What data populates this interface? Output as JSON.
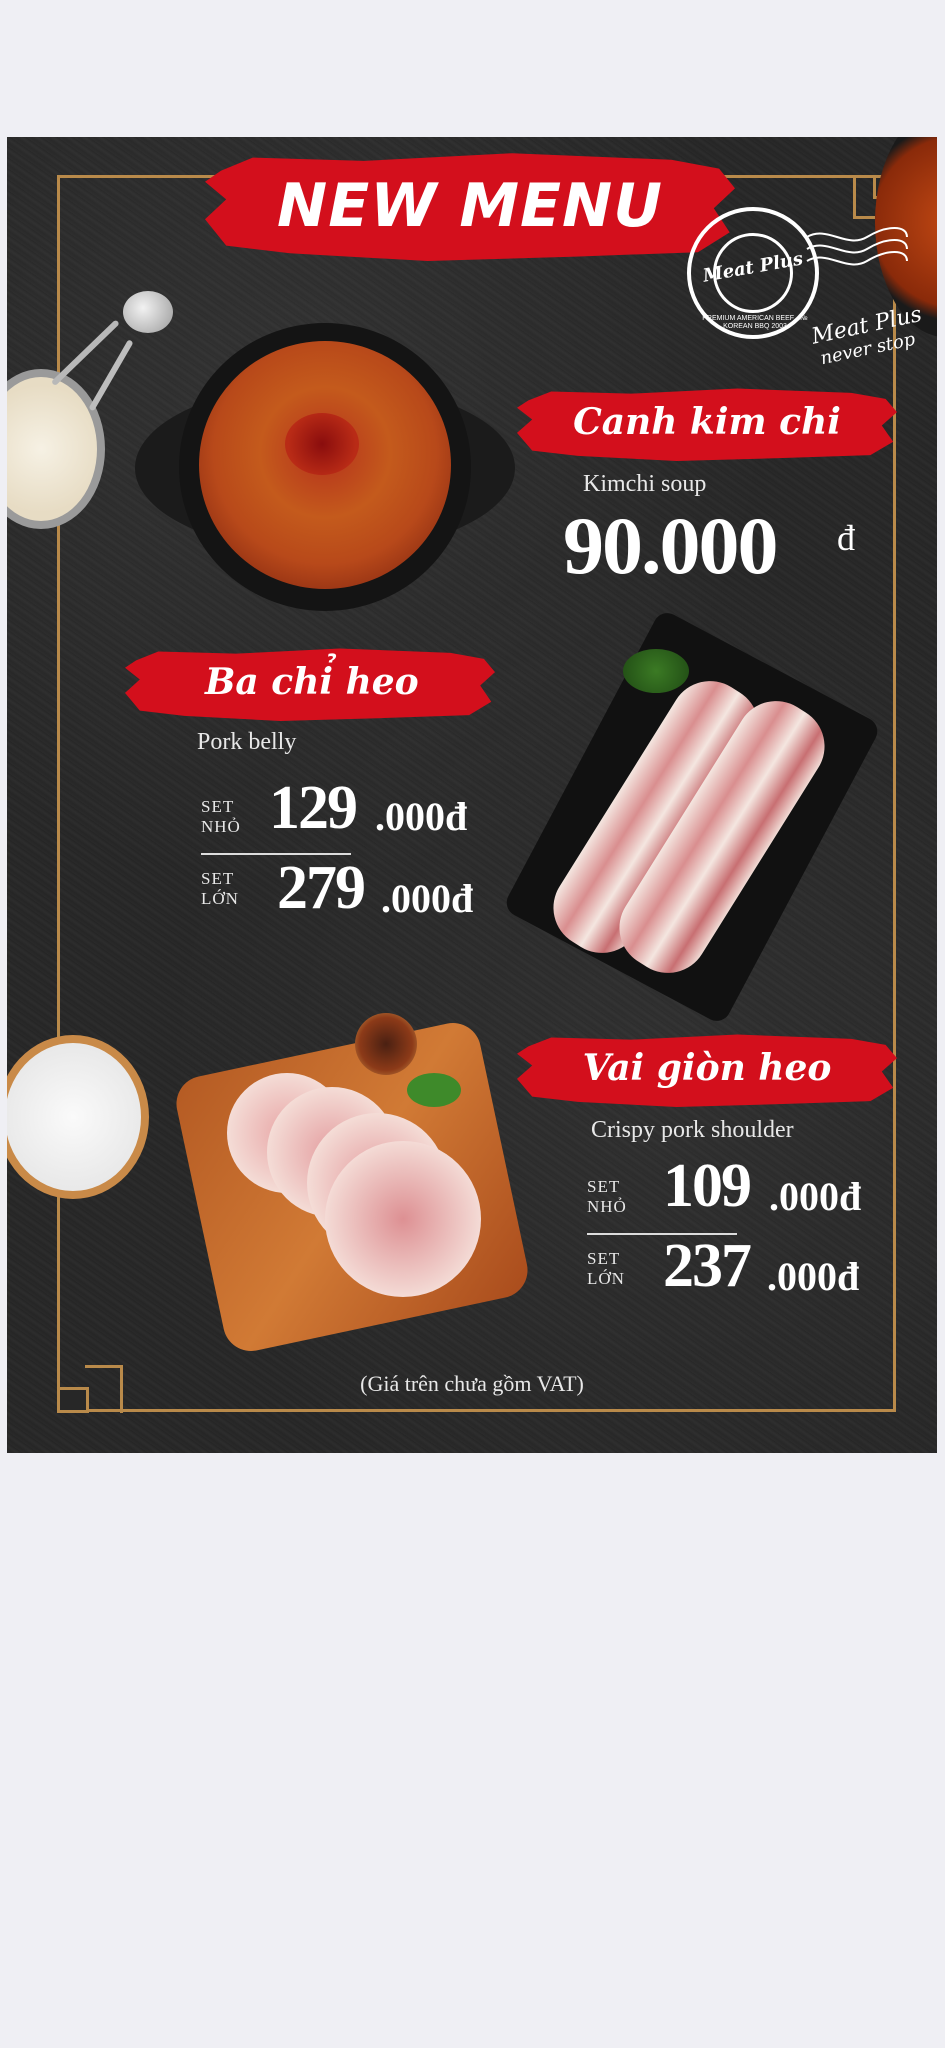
{
  "header": {
    "title": "NEW MENU"
  },
  "brand": {
    "seal_outer_text": "PREMIUM AMERICAN BEEF · № KOREAN BBQ 2003",
    "seal_name": "Meat Plus",
    "slogan_line1": "Meat Plus",
    "slogan_line2": "never stop"
  },
  "items": [
    {
      "name": "Canh kim chi",
      "subtitle": "Kimchi soup",
      "price_main": "90.000",
      "currency": "đ"
    },
    {
      "name": "Ba chỉ heo",
      "subtitle": "Pork belly",
      "sets": [
        {
          "label_line1": "SET",
          "label_line2": "NHỎ",
          "price_main": "129",
          "price_rest": ".000đ"
        },
        {
          "label_line1": "SET",
          "label_line2": "LỚN",
          "price_main": "279",
          "price_rest": ".000đ"
        }
      ]
    },
    {
      "name": "Vai giòn heo",
      "subtitle": "Crispy pork shoulder",
      "sets": [
        {
          "label_line1": "SET",
          "label_line2": "NHỎ",
          "price_main": "109",
          "price_rest": ".000đ"
        },
        {
          "label_line1": "SET",
          "label_line2": "LỚN",
          "price_main": "237",
          "price_rest": ".000đ"
        }
      ]
    }
  ],
  "footer": {
    "note": "(Giá trên chưa gồm VAT)"
  },
  "colors": {
    "accent": "#d30f1c",
    "frame": "#b98a4a",
    "background": "#272727"
  }
}
